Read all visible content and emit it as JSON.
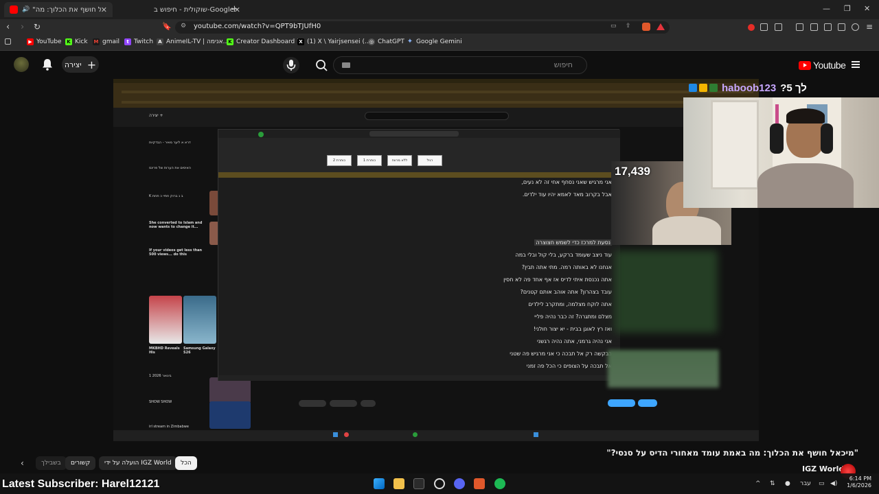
{
  "browser": {
    "tabs": [
      {
        "title": "\"מיכאל חושף את הכלוך: מה\"",
        "active": true
      },
      {
        "title": "שוקולית - חיפוש ב-Google",
        "active": false
      }
    ],
    "new_tab_symbol": "+",
    "url": "youtube.com/watch?v=QPT9bTJUfH0",
    "bookmarks": [
      "YouTube",
      "Kick",
      "gmail",
      "Twitch",
      "AnimeIL-TV | אנימה...",
      "Creator Dashboard |...",
      "(1) X \\ Yairjsensei (...",
      "ChatGPT",
      "Google Gemini"
    ]
  },
  "youtube": {
    "create_label": "יצירה",
    "search_placeholder": "חיפוש",
    "logo_text": "Youtube",
    "video_title": "\"מיכאל חושף את הכלוך: מה באמת עומד מאחורי הדיס על סנסי?\"",
    "channel_name": "IGZ World",
    "chips": [
      "הכל",
      "הועלה על ידי IGZ World",
      "קשורים",
      "בשבילך"
    ]
  },
  "stream_overlay": {
    "chat_user": "haboob123",
    "chat_text": "?לך 5",
    "subscriber_count": "17,439",
    "latest_subscriber_label": "Latest Subscriber: Harel12121"
  },
  "inner_video": {
    "word_lines": [
      "אני מרגיש שאני נסחף אחי זה לא נעים,",
      "אבל בקרוב מאד לאמא יהיו עוד ילדים.",
      "",
      "",
      "נסעת למרכז כדי לשמש חצוצרה",
      "עוד ניצב שעומד ברקע, בלי קול ובלי במה",
      "אנחנו לא באותה רמה. מתי אתה תבין?",
      "אתה נכנסת איתי לדיס אז אף אחד פה לא חסין",
      "עובד בצהרון? אתה אוהב אותם קטנים?",
      "אתה לוקח מצלמה, ומתקרב לילדים",
      "מצלם ומתגרה? זה כבר נהיה פליי",
      "ואז רץ לאוגן בבית - יא יצור חולני!",
      "אני נהיה גרמני, אתה נהיה רגשני",
      "בבקשה רק אל תבכה כי אני מרגיש פה שטני",
      "אל תבכה על הצופים כי הכל פה זמני"
    ],
    "styles": [
      "רגיל",
      "ללא מרווח",
      "כותרת 1",
      "כותרת 2"
    ],
    "sidebar": [
      "דרא א ליער מאיר - הבדקיות",
      "האיסים את הערות של פרינס",
      "K ב נ ברוק חתיי כ תחת",
      "She converted to Islam and now wants to change it...",
      "If your videos get less than 500 views... do this",
      "MKBHD Reveals His",
      "Samsung Galaxy S26",
      "1 בינואר 2026",
      "SHOW SHOW",
      "irl stream in Zimbabwe"
    ]
  },
  "system": {
    "time": "6:14 PM",
    "date": "1/6/2026",
    "lang": "עבר"
  },
  "colors": {
    "yt_red": "#ff0000",
    "bg": "#0f0f0f",
    "chip": "#272727"
  }
}
